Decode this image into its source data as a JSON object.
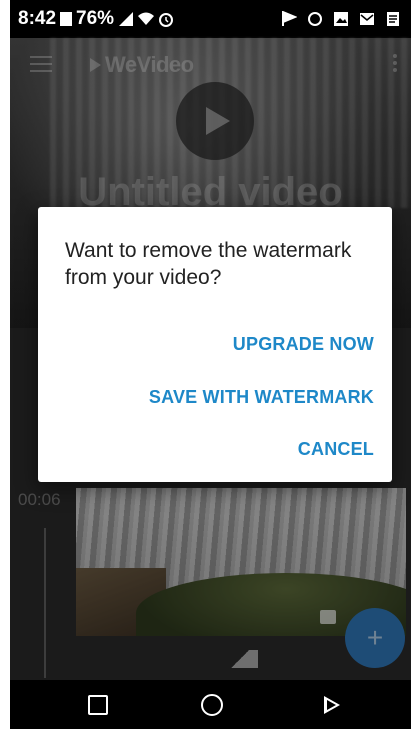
{
  "status_bar": {
    "time": "8:42",
    "battery": "76%"
  },
  "app": {
    "brand": "WeVideo",
    "video_title": "Untitled video",
    "clip_time": "00:06"
  },
  "dialog": {
    "message": "Want to remove the watermark from your video?",
    "actions": {
      "upgrade": "UPGRADE NOW",
      "save": "SAVE WITH WATERMARK",
      "cancel": "CANCEL"
    }
  },
  "colors": {
    "accent": "#1e88c8",
    "fab": "#2e75b6"
  }
}
